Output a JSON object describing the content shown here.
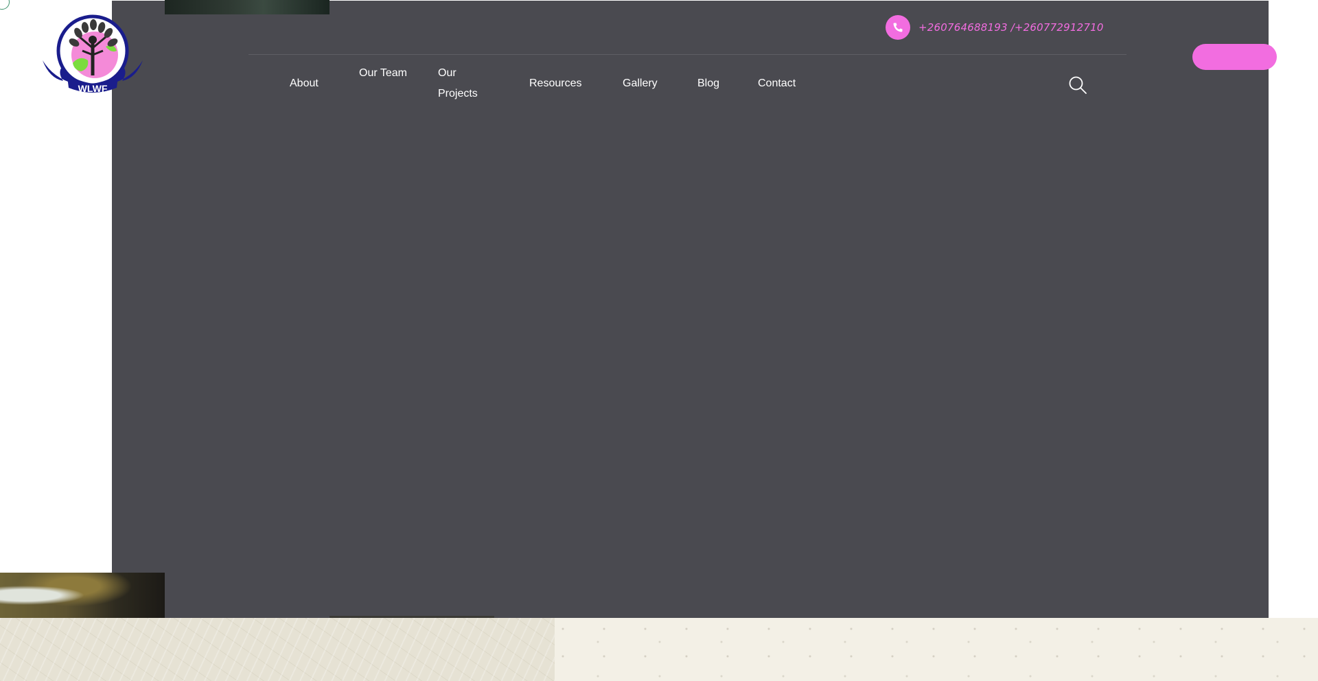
{
  "header": {
    "phone": "+260764688193 /+260772912710",
    "logo_text": "WLWF",
    "search_label": "",
    "cta_label": ""
  },
  "nav": {
    "items": [
      {
        "label": "About"
      },
      {
        "label": "Our Team"
      },
      {
        "label": "Our Projects"
      },
      {
        "label": "Resources"
      },
      {
        "label": "Gallery"
      },
      {
        "label": "Blog"
      },
      {
        "label": "Contact"
      }
    ]
  },
  "colors": {
    "accent_pink": "#f26de0",
    "overlay_dark": "#4a4a50",
    "logo_navy": "#1a1d8c",
    "logo_green": "#7bdc3e"
  },
  "icons": {
    "phone": "phone-icon",
    "search": "search-icon",
    "logo": "wlwf-logo"
  }
}
